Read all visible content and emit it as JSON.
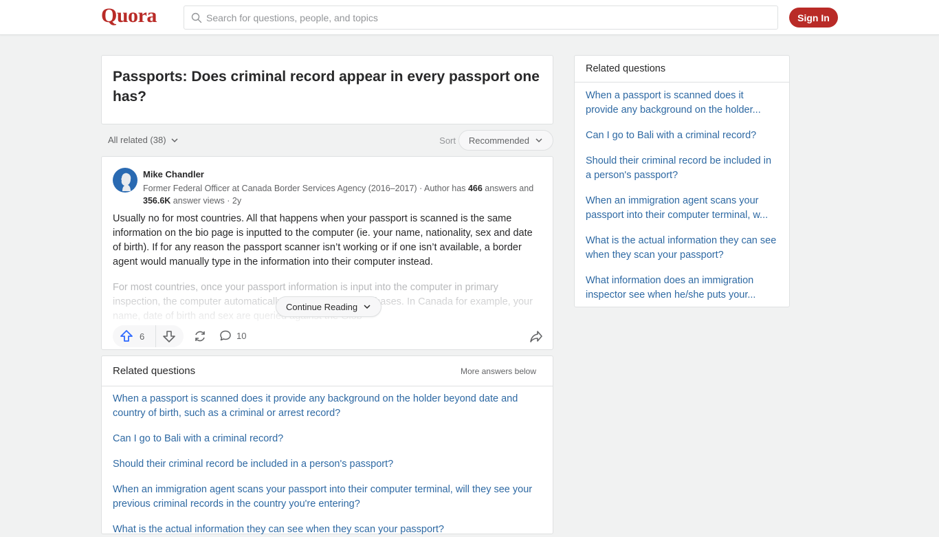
{
  "header": {
    "logo": "Quora",
    "search_placeholder": "Search for questions, people, and topics",
    "signin_label": "Sign In",
    "brand_color": "#b92b27"
  },
  "question": {
    "title": "Passports: Does criminal record appear in every passport one has?"
  },
  "filter": {
    "all_related_label": "All related (38)",
    "sort_label": "Sort",
    "sort_value": "Recommended"
  },
  "answer": {
    "author_name": "Mike Chandler",
    "credential_prefix": "Former Federal Officer at Canada Border Services Agency (2016–2017) · Author has ",
    "answers_count": "466",
    "credential_mid": " answers and ",
    "views_count": "356.6K",
    "credential_suffix": " answer views · 2y",
    "paragraph_1": "Usually no for most countries. All that happens when your passport is scanned is the same information on the bio page is inputted to the computer (ie. your name, nationality, sex and date of birth). If for any reason the passport scanner isn’t working or if one isn’t available, a border agent would manually type in the information into their computer instead.",
    "paragraph_2": "For most countries, once your passport information is input into the computer in primary inspection, the computer automatically queries several databases. In Canada for example, your name, date of birth and sex are queried against the Glob",
    "continue_label": "Continue Reading",
    "upvotes": "6",
    "comments": "10"
  },
  "related_main": {
    "title": "Related questions",
    "more_label": "More answers below",
    "items": [
      "When a passport is scanned does it provide any background on the holder beyond date and country of birth, such as a criminal or arrest record?",
      "Can I go to Bali with a criminal record?",
      "Should their criminal record be included in a person's passport?",
      "When an immigration agent scans your passport into their computer terminal, will they see your previous criminal records in the country you're entering?",
      "What is the actual information they can see when they scan your passport?"
    ]
  },
  "related_side": {
    "title": "Related questions",
    "items": [
      "When a passport is scanned does it provide any background on the holder...",
      "Can I go to Bali with a criminal record?",
      "Should their criminal record be included in a person's passport?",
      "When an immigration agent scans your passport into their computer terminal, w...",
      "What is the actual information they can see when they scan your passport?",
      "What information does an immigration inspector see when he/she puts your..."
    ]
  }
}
